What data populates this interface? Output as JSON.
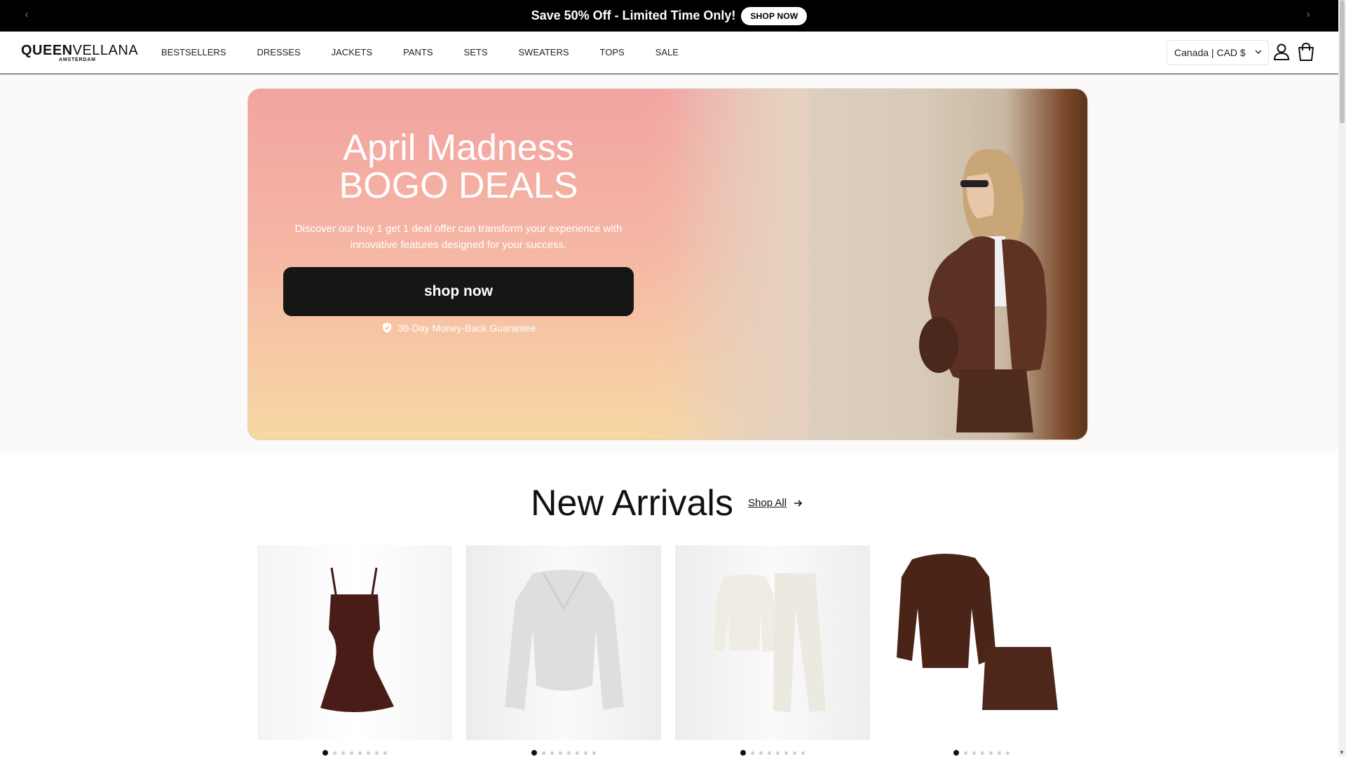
{
  "announcement": {
    "text": "Save 50% Off - Limited Time Only!",
    "button": "SHOP NOW",
    "prev_icon": "chevron-left-icon",
    "next_icon": "chevron-right-icon"
  },
  "header": {
    "logo_main_bold": "QUEEN",
    "logo_main_light": "VELLANA",
    "logo_sub": "AMSTERDAM",
    "nav": [
      "BESTSELLERS",
      "DRESSES",
      "JACKETS",
      "PANTS",
      "SETS",
      "SWEATERS",
      "TOPS",
      "SALE"
    ],
    "currency": "Canada | CAD $",
    "account_icon": "user-icon",
    "cart_icon": "cart-icon"
  },
  "hero": {
    "title_line1": "April Madness",
    "title_line2": "BOGO DEALS",
    "description": "Discover our buy 1 get 1 deal offer can transform your experience with innovative features designed for your success.",
    "button": "shop now",
    "guarantee": "30-Day Money-Back Guarantee"
  },
  "new_arrivals": {
    "title": "New Arrivals",
    "link": "Shop All",
    "products": [
      {
        "image": "brown-mini-dress",
        "dots": 8
      },
      {
        "image": "grey-wrap-sweater",
        "dots": 8
      },
      {
        "image": "cream-top-pants-set",
        "dots": 8
      },
      {
        "image": "brown-jacket-skirt-set",
        "dots": 7
      }
    ]
  },
  "colors": {
    "announcement_bg": "#000000",
    "hero_gradient_top": "#f2a3a1",
    "hero_gradient_bottom": "#f7d8a4",
    "button_bg": "#161616"
  }
}
